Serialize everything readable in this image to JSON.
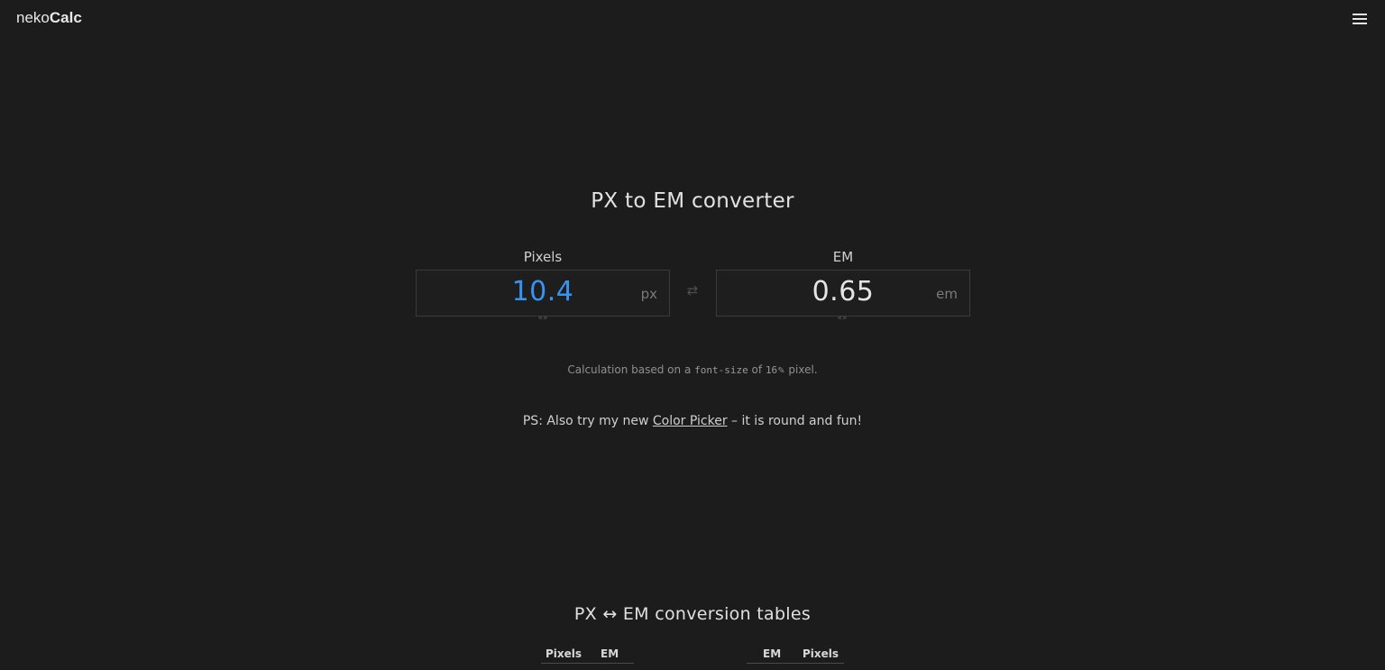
{
  "header": {
    "logo_light": "neko",
    "logo_bold": "Calc",
    "menu_icon": "hamburger-menu-icon"
  },
  "converter": {
    "title": "PX to EM converter",
    "pixels": {
      "label": "Pixels",
      "value": "10.4",
      "unit": "px"
    },
    "em": {
      "label": "EM",
      "value": "0.65",
      "unit": "em"
    },
    "swap_glyph": "⇄",
    "drag_glyph": "«»",
    "accent_color": "#3794f2"
  },
  "note": {
    "prefix": "Calculation based on a ",
    "code": "font-size",
    "middle": " of ",
    "base_size": "16",
    "suffix": " pixel."
  },
  "ps": {
    "prefix": "PS: Also try my new ",
    "link": "Color Picker",
    "suffix": " – it is round and fun!"
  },
  "tables": {
    "title": "PX ↔ EM conversion tables",
    "left": {
      "col1": "Pixels",
      "col2": "EM"
    },
    "right": {
      "col1": "EM",
      "col2": "Pixels"
    }
  }
}
